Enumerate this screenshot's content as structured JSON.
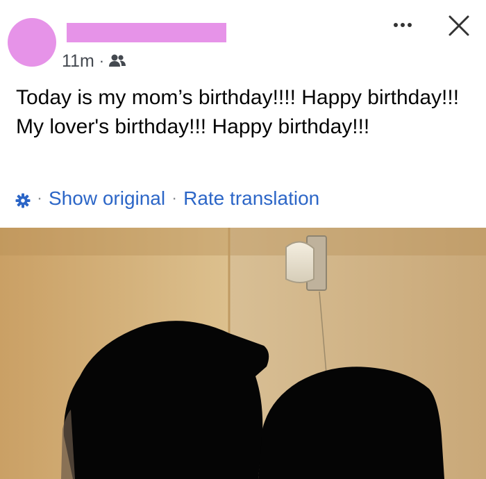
{
  "post": {
    "timestamp": "11m",
    "meta_separator": "·",
    "audience_icon": "friends-icon",
    "body_lines": [
      "Today is my mom’s birthday!!!! Happy birthday!!!",
      "My lover's birthday!!! Happy birthday!!!"
    ],
    "translation": {
      "icon": "gear-icon",
      "separator": "·",
      "show_original": "Show original",
      "rate_translation": "Rate translation"
    }
  },
  "colors": {
    "redaction": "#e693e8",
    "link": "#2c66c7",
    "meta": "#444950"
  }
}
